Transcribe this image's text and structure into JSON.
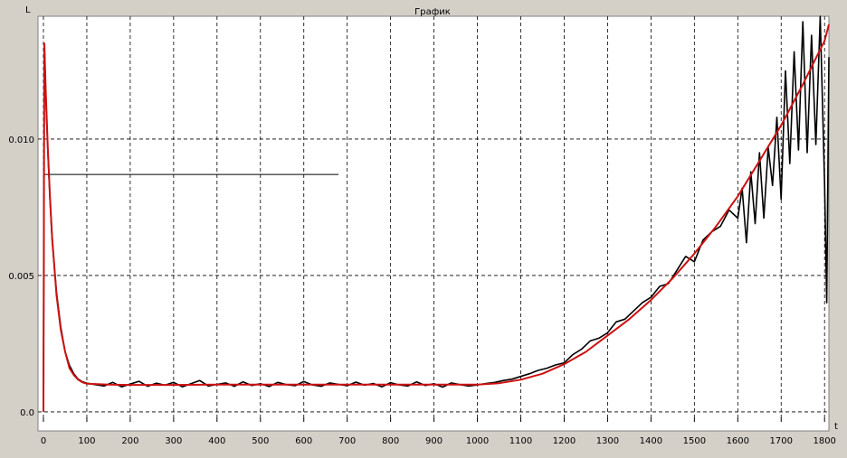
{
  "chart_data": {
    "type": "line",
    "title": "График",
    "xlabel": "t",
    "ylabel": "L",
    "xlim": [
      0,
      1810
    ],
    "ylim": [
      -0.0002,
      0.0145
    ],
    "xticks": [
      0,
      100,
      200,
      300,
      400,
      500,
      600,
      700,
      800,
      900,
      1000,
      1100,
      1200,
      1300,
      1400,
      1500,
      1600,
      1700,
      1800
    ],
    "yticks": [
      0.0,
      0.005,
      0.01
    ],
    "ytick_labels": [
      "0.0",
      "0.005",
      "0.010"
    ],
    "grid": true,
    "legend": "none",
    "reference_line": {
      "y": 0.0087,
      "x_start": 0,
      "x_end": 680,
      "color": "#000000"
    },
    "series": [
      {
        "color": "#000000",
        "x": [
          0,
          2,
          5,
          10,
          15,
          20,
          30,
          40,
          50,
          60,
          70,
          80,
          90,
          100,
          120,
          140,
          160,
          180,
          200,
          220,
          240,
          260,
          280,
          300,
          320,
          340,
          360,
          380,
          400,
          420,
          440,
          460,
          480,
          500,
          520,
          540,
          560,
          580,
          600,
          620,
          640,
          660,
          680,
          700,
          720,
          740,
          760,
          780,
          800,
          820,
          840,
          860,
          880,
          900,
          920,
          940,
          960,
          980,
          1000,
          1020,
          1040,
          1060,
          1080,
          1100,
          1120,
          1140,
          1160,
          1180,
          1200,
          1220,
          1240,
          1260,
          1280,
          1300,
          1320,
          1340,
          1360,
          1380,
          1400,
          1420,
          1440,
          1460,
          1480,
          1500,
          1520,
          1540,
          1560,
          1580,
          1600,
          1610,
          1620,
          1630,
          1640,
          1650,
          1660,
          1670,
          1680,
          1690,
          1700,
          1710,
          1720,
          1730,
          1740,
          1750,
          1760,
          1770,
          1780,
          1790,
          1800,
          1805,
          1810
        ],
        "y": [
          0.0,
          0.0135,
          0.0118,
          0.0096,
          0.0078,
          0.0063,
          0.0044,
          0.0031,
          0.0022,
          0.0017,
          0.0014,
          0.0012,
          0.0011,
          0.00105,
          0.001,
          0.00095,
          0.00108,
          0.00092,
          0.00102,
          0.00112,
          0.00094,
          0.00105,
          0.00098,
          0.00108,
          0.00092,
          0.00103,
          0.00115,
          0.00095,
          0.00101,
          0.00106,
          0.00094,
          0.0011,
          0.00097,
          0.00103,
          0.00093,
          0.00108,
          0.001,
          0.00096,
          0.00111,
          0.00099,
          0.00094,
          0.00106,
          0.00101,
          0.00096,
          0.00109,
          0.00098,
          0.00104,
          0.00092,
          0.00107,
          0.00099,
          0.00095,
          0.0011,
          0.00097,
          0.00103,
          0.00091,
          0.00106,
          0.001,
          0.00095,
          0.00099,
          0.00104,
          0.00108,
          0.00115,
          0.0012,
          0.0013,
          0.0014,
          0.00152,
          0.0016,
          0.00172,
          0.0018,
          0.0021,
          0.0023,
          0.0026,
          0.0027,
          0.0029,
          0.0033,
          0.0034,
          0.0037,
          0.004,
          0.0042,
          0.0046,
          0.0047,
          0.0052,
          0.0057,
          0.0055,
          0.0063,
          0.0066,
          0.0068,
          0.0074,
          0.0071,
          0.0082,
          0.0062,
          0.0088,
          0.0069,
          0.0095,
          0.0071,
          0.0097,
          0.0083,
          0.0108,
          0.0078,
          0.0125,
          0.0091,
          0.0132,
          0.0096,
          0.0143,
          0.0095,
          0.0138,
          0.0098,
          0.0145,
          0.0084,
          0.004,
          0.013
        ]
      },
      {
        "color": "#cc1111",
        "x": [
          0,
          2,
          5,
          10,
          15,
          20,
          30,
          40,
          50,
          60,
          70,
          80,
          90,
          100,
          150,
          200,
          300,
          400,
          500,
          600,
          700,
          800,
          900,
          1000,
          1050,
          1100,
          1150,
          1200,
          1250,
          1300,
          1350,
          1400,
          1450,
          1500,
          1550,
          1600,
          1650,
          1700,
          1750,
          1800,
          1810
        ],
        "y": [
          0.0,
          0.0135,
          0.0119,
          0.0097,
          0.0079,
          0.0064,
          0.0043,
          0.003,
          0.0022,
          0.0016,
          0.00135,
          0.00118,
          0.00108,
          0.00103,
          0.001,
          0.00099,
          0.00099,
          0.001,
          0.001,
          0.001,
          0.001,
          0.001,
          0.001,
          0.001,
          0.00105,
          0.00118,
          0.0014,
          0.00175,
          0.0022,
          0.0028,
          0.0034,
          0.0041,
          0.0049,
          0.0058,
          0.0068,
          0.0079,
          0.0092,
          0.0105,
          0.012,
          0.0136,
          0.0142
        ]
      }
    ]
  }
}
